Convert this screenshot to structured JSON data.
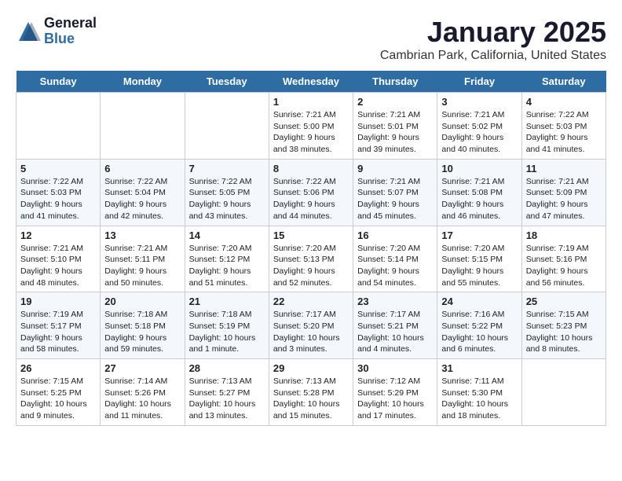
{
  "header": {
    "logo_line1": "General",
    "logo_line2": "Blue",
    "month": "January 2025",
    "location": "Cambrian Park, California, United States"
  },
  "days_of_week": [
    "Sunday",
    "Monday",
    "Tuesday",
    "Wednesday",
    "Thursday",
    "Friday",
    "Saturday"
  ],
  "weeks": [
    [
      {
        "day": "",
        "content": ""
      },
      {
        "day": "",
        "content": ""
      },
      {
        "day": "",
        "content": ""
      },
      {
        "day": "1",
        "content": "Sunrise: 7:21 AM\nSunset: 5:00 PM\nDaylight: 9 hours and 38 minutes."
      },
      {
        "day": "2",
        "content": "Sunrise: 7:21 AM\nSunset: 5:01 PM\nDaylight: 9 hours and 39 minutes."
      },
      {
        "day": "3",
        "content": "Sunrise: 7:21 AM\nSunset: 5:02 PM\nDaylight: 9 hours and 40 minutes."
      },
      {
        "day": "4",
        "content": "Sunrise: 7:22 AM\nSunset: 5:03 PM\nDaylight: 9 hours and 41 minutes."
      }
    ],
    [
      {
        "day": "5",
        "content": "Sunrise: 7:22 AM\nSunset: 5:03 PM\nDaylight: 9 hours and 41 minutes."
      },
      {
        "day": "6",
        "content": "Sunrise: 7:22 AM\nSunset: 5:04 PM\nDaylight: 9 hours and 42 minutes."
      },
      {
        "day": "7",
        "content": "Sunrise: 7:22 AM\nSunset: 5:05 PM\nDaylight: 9 hours and 43 minutes."
      },
      {
        "day": "8",
        "content": "Sunrise: 7:22 AM\nSunset: 5:06 PM\nDaylight: 9 hours and 44 minutes."
      },
      {
        "day": "9",
        "content": "Sunrise: 7:21 AM\nSunset: 5:07 PM\nDaylight: 9 hours and 45 minutes."
      },
      {
        "day": "10",
        "content": "Sunrise: 7:21 AM\nSunset: 5:08 PM\nDaylight: 9 hours and 46 minutes."
      },
      {
        "day": "11",
        "content": "Sunrise: 7:21 AM\nSunset: 5:09 PM\nDaylight: 9 hours and 47 minutes."
      }
    ],
    [
      {
        "day": "12",
        "content": "Sunrise: 7:21 AM\nSunset: 5:10 PM\nDaylight: 9 hours and 48 minutes."
      },
      {
        "day": "13",
        "content": "Sunrise: 7:21 AM\nSunset: 5:11 PM\nDaylight: 9 hours and 50 minutes."
      },
      {
        "day": "14",
        "content": "Sunrise: 7:20 AM\nSunset: 5:12 PM\nDaylight: 9 hours and 51 minutes."
      },
      {
        "day": "15",
        "content": "Sunrise: 7:20 AM\nSunset: 5:13 PM\nDaylight: 9 hours and 52 minutes."
      },
      {
        "day": "16",
        "content": "Sunrise: 7:20 AM\nSunset: 5:14 PM\nDaylight: 9 hours and 54 minutes."
      },
      {
        "day": "17",
        "content": "Sunrise: 7:20 AM\nSunset: 5:15 PM\nDaylight: 9 hours and 55 minutes."
      },
      {
        "day": "18",
        "content": "Sunrise: 7:19 AM\nSunset: 5:16 PM\nDaylight: 9 hours and 56 minutes."
      }
    ],
    [
      {
        "day": "19",
        "content": "Sunrise: 7:19 AM\nSunset: 5:17 PM\nDaylight: 9 hours and 58 minutes."
      },
      {
        "day": "20",
        "content": "Sunrise: 7:18 AM\nSunset: 5:18 PM\nDaylight: 9 hours and 59 minutes."
      },
      {
        "day": "21",
        "content": "Sunrise: 7:18 AM\nSunset: 5:19 PM\nDaylight: 10 hours and 1 minute."
      },
      {
        "day": "22",
        "content": "Sunrise: 7:17 AM\nSunset: 5:20 PM\nDaylight: 10 hours and 3 minutes."
      },
      {
        "day": "23",
        "content": "Sunrise: 7:17 AM\nSunset: 5:21 PM\nDaylight: 10 hours and 4 minutes."
      },
      {
        "day": "24",
        "content": "Sunrise: 7:16 AM\nSunset: 5:22 PM\nDaylight: 10 hours and 6 minutes."
      },
      {
        "day": "25",
        "content": "Sunrise: 7:15 AM\nSunset: 5:23 PM\nDaylight: 10 hours and 8 minutes."
      }
    ],
    [
      {
        "day": "26",
        "content": "Sunrise: 7:15 AM\nSunset: 5:25 PM\nDaylight: 10 hours and 9 minutes."
      },
      {
        "day": "27",
        "content": "Sunrise: 7:14 AM\nSunset: 5:26 PM\nDaylight: 10 hours and 11 minutes."
      },
      {
        "day": "28",
        "content": "Sunrise: 7:13 AM\nSunset: 5:27 PM\nDaylight: 10 hours and 13 minutes."
      },
      {
        "day": "29",
        "content": "Sunrise: 7:13 AM\nSunset: 5:28 PM\nDaylight: 10 hours and 15 minutes."
      },
      {
        "day": "30",
        "content": "Sunrise: 7:12 AM\nSunset: 5:29 PM\nDaylight: 10 hours and 17 minutes."
      },
      {
        "day": "31",
        "content": "Sunrise: 7:11 AM\nSunset: 5:30 PM\nDaylight: 10 hours and 18 minutes."
      },
      {
        "day": "",
        "content": ""
      }
    ]
  ]
}
